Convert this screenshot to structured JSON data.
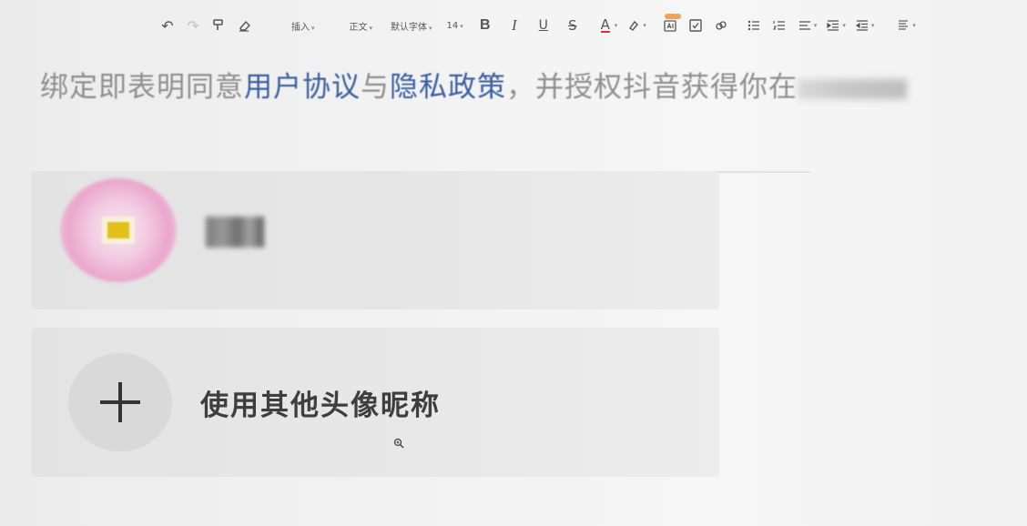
{
  "toolbar": {
    "undo_icon": "undo-icon",
    "redo_icon": "redo-icon",
    "format_painter_icon": "format-painter-icon",
    "eraser_icon": "eraser-icon",
    "insert_label": "插入",
    "style_label": "正文",
    "font_label": "默认字体",
    "size_label": "14",
    "bold_label": "B",
    "italic_label": "I",
    "underline_label": "U",
    "strike_label": "S",
    "font_color_label": "A",
    "font_color": "#d9342b",
    "highlight_icon": "highlight-icon",
    "ai_icon": "ai-icon",
    "checkbox_icon": "checkbox-icon",
    "link_icon": "link-icon",
    "bullet_list_icon": "bullet-list-icon",
    "numbered_list_icon": "numbered-list-icon",
    "align_icon": "align-icon",
    "indent_icon": "indent-icon",
    "outdent_icon": "outdent-icon",
    "more_icon": "more-icon"
  },
  "agreement": {
    "prefix": "绑定即表明同意",
    "user_agreement": "用户协议",
    "and": "与",
    "privacy_policy": "隐私政策",
    "suffix": "，并授权抖音获得你在",
    "link_color": "#3b5fa0"
  },
  "account_card": {
    "avatar_icon": "avatar-icon"
  },
  "other_card": {
    "plus_icon": "plus-icon",
    "label": "使用其他头像昵称"
  },
  "cursor": {
    "icon": "zoom-cursor-icon"
  }
}
